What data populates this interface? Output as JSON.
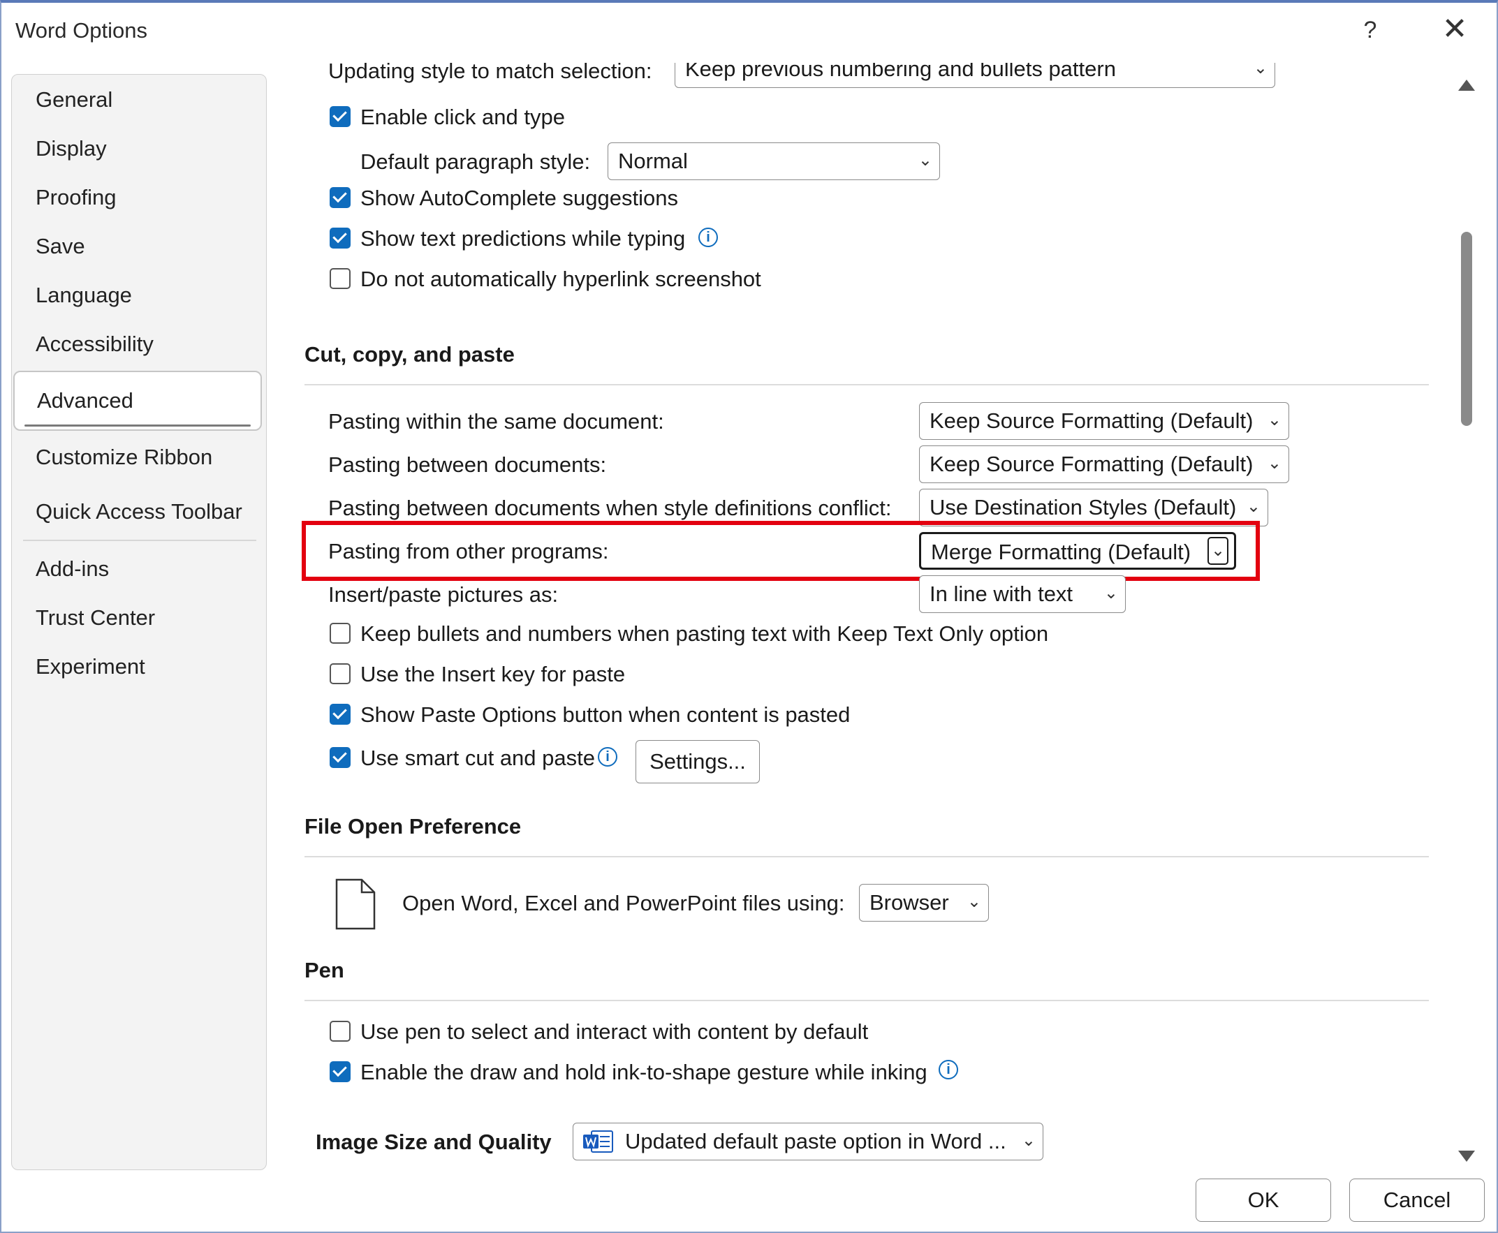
{
  "window": {
    "title": "Word Options",
    "help": "?",
    "close": "✕"
  },
  "nav": {
    "items": [
      "General",
      "Display",
      "Proofing",
      "Save",
      "Language",
      "Accessibility",
      "Advanced",
      "Customize Ribbon",
      "Quick Access Toolbar",
      "Add-ins",
      "Trust Center",
      "Experiment"
    ],
    "selected": "Advanced"
  },
  "editing": {
    "updating_style_label": "Updating style to match selection:",
    "updating_style_value": "Keep previous numbering and bullets pattern",
    "enable_click_type": "Enable click and type",
    "default_paragraph_label": "Default paragraph style:",
    "default_paragraph_value": "Normal",
    "show_autocomplete": "Show AutoComplete suggestions",
    "show_text_predictions": "Show text predictions while typing",
    "no_auto_hyperlink": "Do not automatically hyperlink screenshot"
  },
  "cut_copy_paste": {
    "heading": "Cut, copy, and paste",
    "rows": [
      {
        "label": "Pasting within the same document:",
        "value": "Keep Source Formatting (Default)"
      },
      {
        "label": "Pasting between documents:",
        "value": "Keep Source Formatting (Default)"
      },
      {
        "label": "Pasting between documents when style definitions conflict:",
        "value": "Use Destination Styles (Default)"
      },
      {
        "label": "Pasting from other programs:",
        "value": "Merge Formatting (Default)"
      },
      {
        "label": "Insert/paste pictures as:",
        "value": "In line with text"
      }
    ],
    "keep_bullets": "Keep bullets and numbers when pasting text with Keep Text Only option",
    "insert_key": "Use the Insert key for paste",
    "show_paste_options": "Show Paste Options button when content is pasted",
    "smart_cut": "Use smart cut and paste",
    "settings_button": "Settings..."
  },
  "file_open": {
    "heading": "File Open Preference",
    "label": "Open Word, Excel and PowerPoint files using:",
    "value": "Browser"
  },
  "pen": {
    "heading": "Pen",
    "use_pen": "Use pen to select and interact with content by default",
    "ink_to_shape": "Enable the draw and hold ink-to-shape gesture while inking"
  },
  "image_quality": {
    "heading": "Image Size and Quality",
    "value": "Updated default paste option in Word ..."
  },
  "footer": {
    "ok": "OK",
    "cancel": "Cancel"
  },
  "colors": {
    "accent": "#0f6cbd",
    "highlight": "#e3000f"
  },
  "icons": [
    "help-icon",
    "close-icon",
    "checkbox-checked-icon",
    "checkbox-unchecked-icon",
    "chevron-down-icon",
    "info-icon",
    "document-icon",
    "word-document-icon",
    "scroll-up-icon",
    "scroll-down-icon"
  ]
}
